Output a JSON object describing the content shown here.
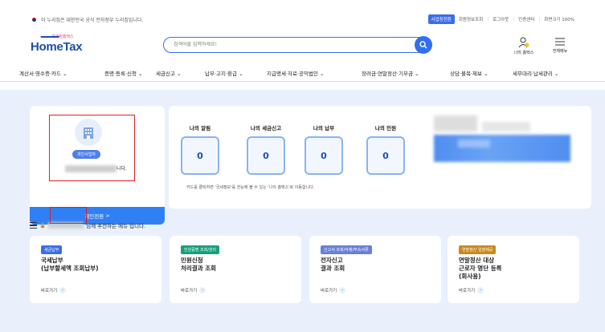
{
  "topbar": {
    "gov_notice": "이 누리집은 대한민국 공식 전자정부 누리집입니다.",
    "links": [
      "사업장전환",
      "회원정보조회",
      "로그아웃",
      "인증센터",
      "화면크기 100%"
    ]
  },
  "header": {
    "logo_sub": "국세청홈택스",
    "logo_main": "HomeTax",
    "search_placeholder": "검색어를 입력하세요!",
    "myhome_label": "나의 홈택스",
    "allmenu_label": "전체메뉴"
  },
  "nav": [
    "계산서·영수증·카드",
    "증명·등록·신청",
    "세금신고",
    "납부·고지·환급",
    "지급명세·자료·공익법인",
    "장려금·연말정산·기부금",
    "상담·불복·제보",
    "세무대리·납세관리"
  ],
  "profile": {
    "role": "개인사업자",
    "name_suffix": "니다.",
    "switch_button": "개인전환"
  },
  "status": {
    "items": [
      {
        "label": "나의 알림",
        "count": "0"
      },
      {
        "label": "나의 세금신고",
        "count": "0"
      },
      {
        "label": "나의 납부",
        "count": "0"
      },
      {
        "label": "나의 민원",
        "count": "0"
      }
    ],
    "note": "카드를 클릭하면 '국세정보'를 한눈에 볼 수 있는 '나의 홈택스'로 이동합니다."
  },
  "recommend": {
    "title_suffix": "님께 추천하는 메뉴 입니다."
  },
  "tiles": [
    {
      "tag": "세금납부",
      "tag_color": "#3a6ee8",
      "title": "국세납부\n(납부할세액 조회납부)",
      "go": "바로가기"
    },
    {
      "tag": "민원증명 조회/관리",
      "tag_color": "#17a07a",
      "title": "민원신청\n처리결과 조회",
      "go": "바로가기"
    },
    {
      "tag": "신고서 조회/삭제/부속서류",
      "tag_color": "#6a7fd8",
      "title": "전자신고\n결과 조회",
      "go": "바로가기"
    },
    {
      "tag": "연말정산 일괄제공",
      "tag_color": "#c8891e",
      "title": "연말정산 대상\n근로자 명단 등록\n(회사용)",
      "go": "바로가기"
    }
  ]
}
